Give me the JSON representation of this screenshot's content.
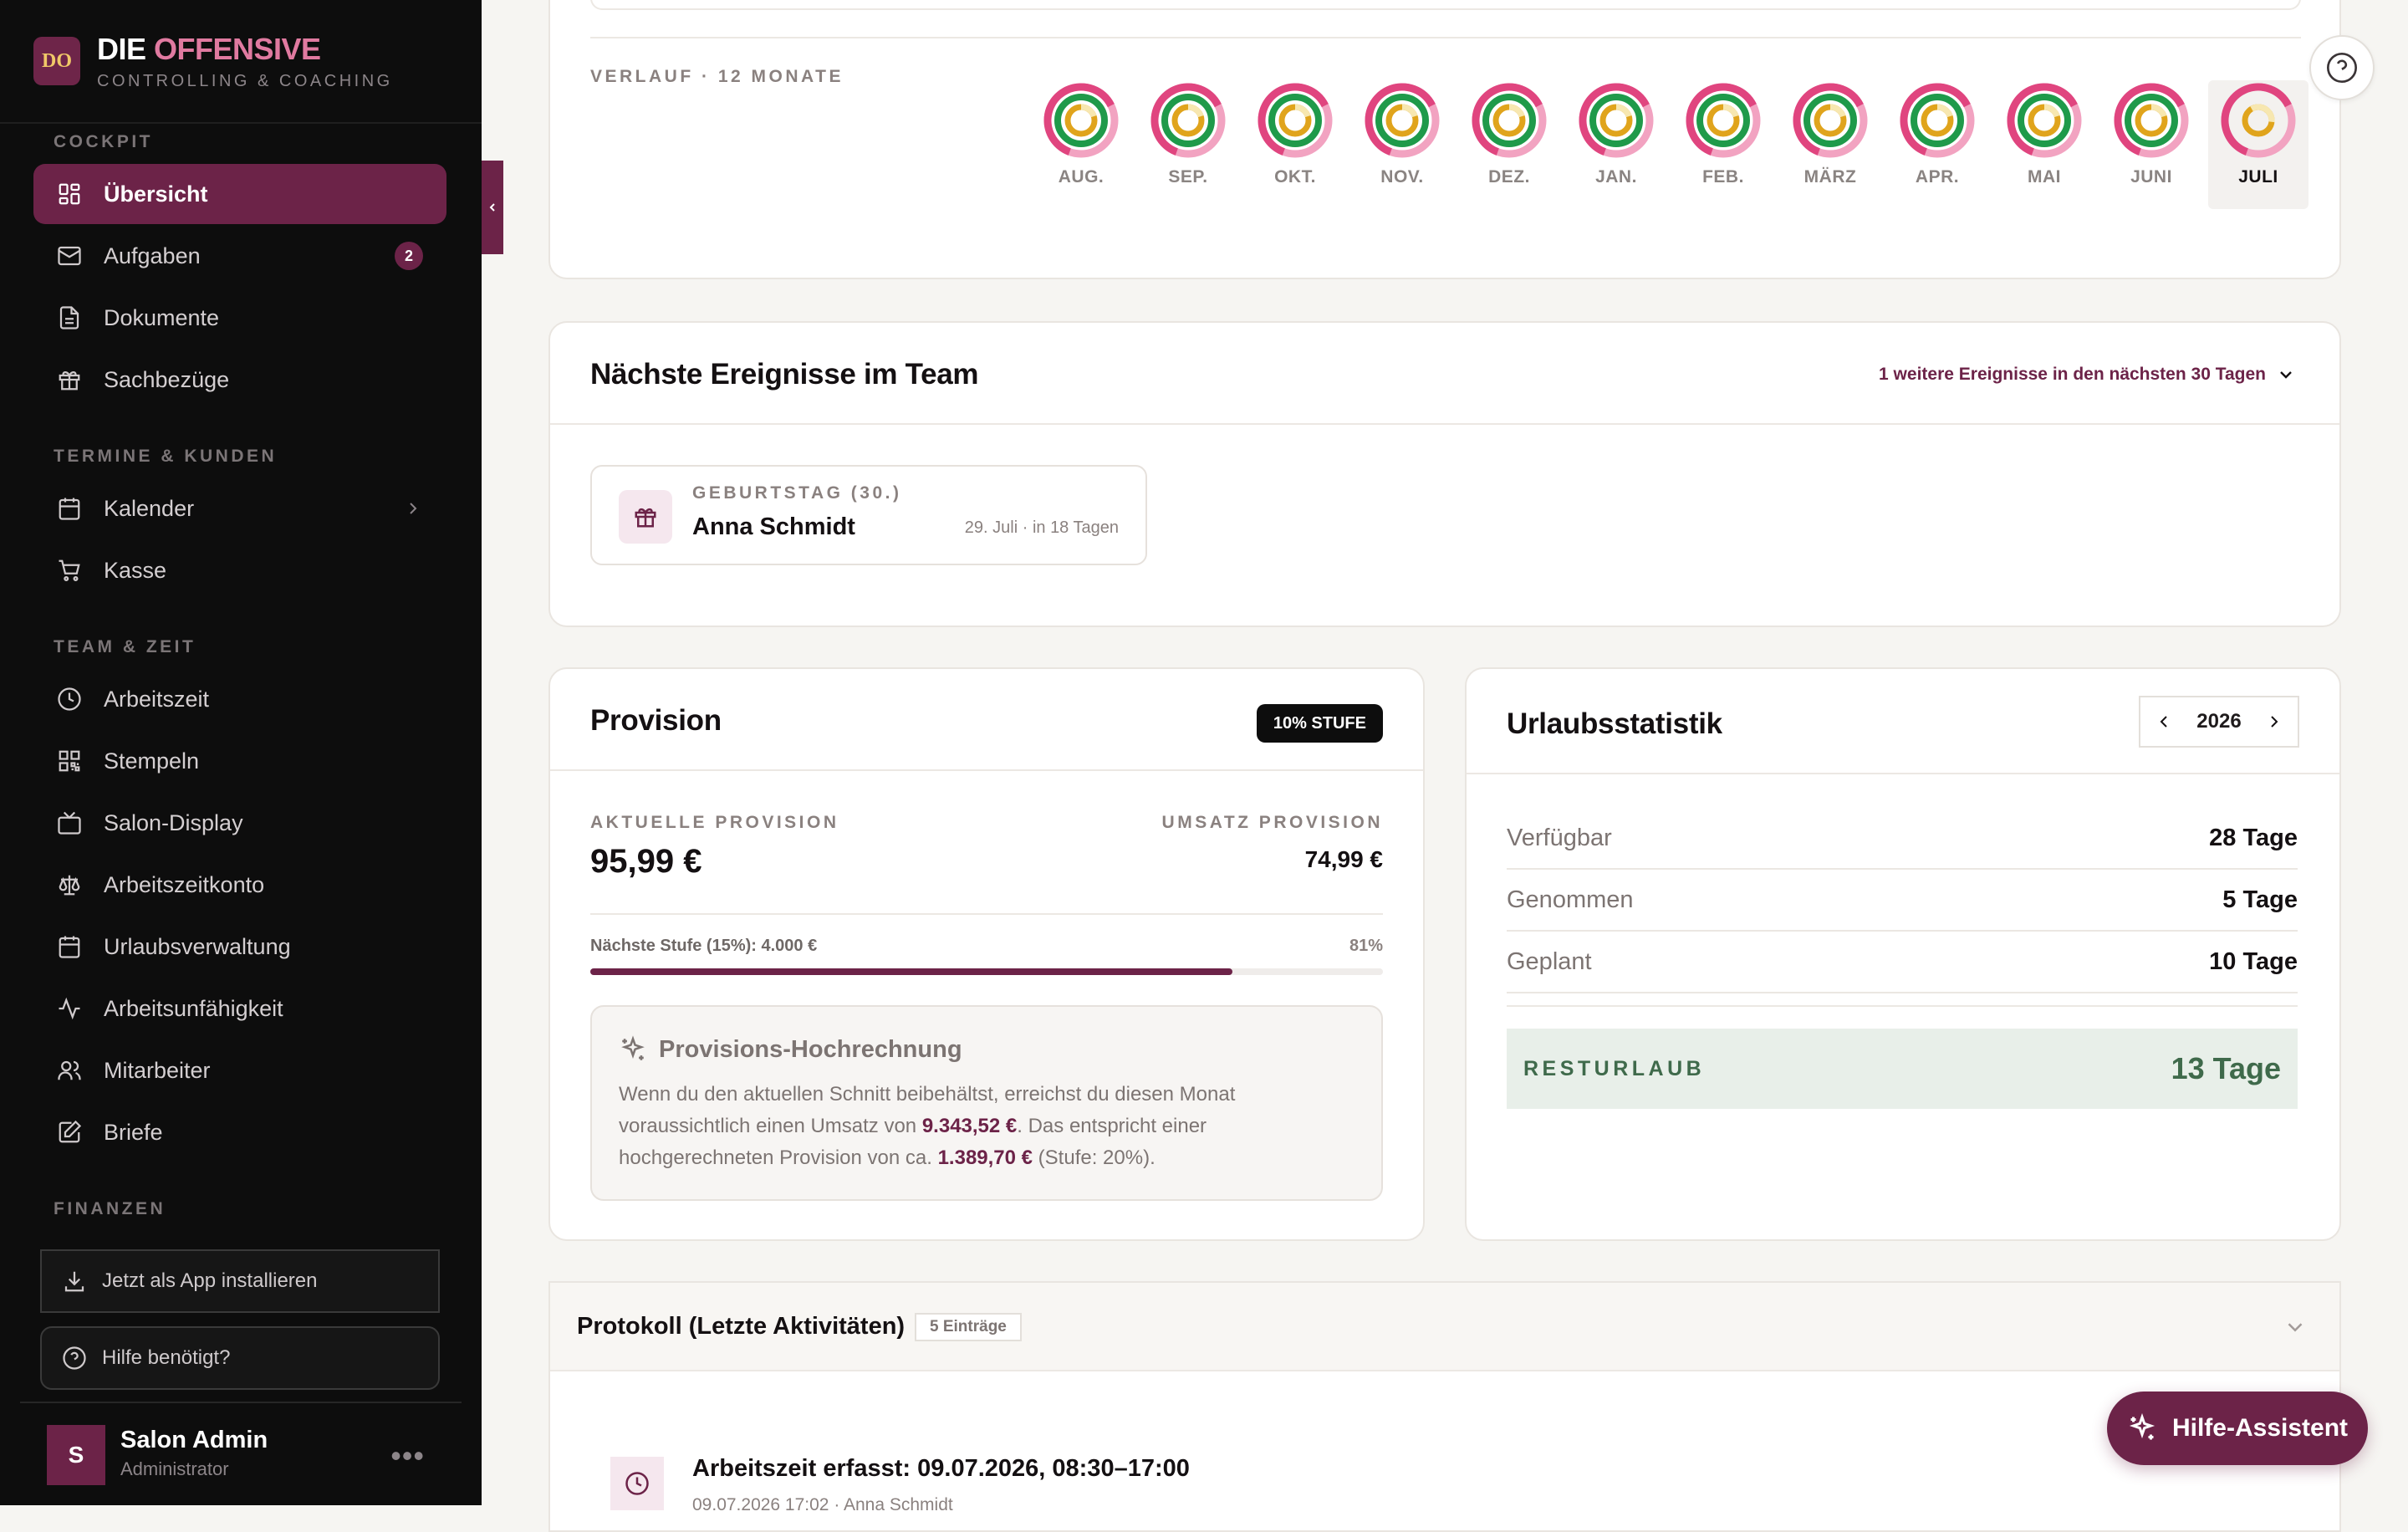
{
  "brand": {
    "name_part1": "DIE ",
    "name_part2": "OFFENSIVE",
    "subtitle": "CONTROLLING & COACHING",
    "logo_text": "DO"
  },
  "sidebar": {
    "sections": {
      "cockpit": "COCKPIT",
      "termine": "TERMINE & KUNDEN",
      "team": "TEAM & ZEIT",
      "finanzen": "FINANZEN"
    },
    "items": [
      {
        "label": "Übersicht",
        "icon": "grid-icon",
        "active": true
      },
      {
        "label": "Aufgaben",
        "icon": "mail-icon",
        "badge": "2"
      },
      {
        "label": "Dokumente",
        "icon": "document-icon"
      },
      {
        "label": "Sachbezüge",
        "icon": "gift-icon"
      },
      {
        "label": "Kalender",
        "icon": "calendar-icon"
      },
      {
        "label": "Kasse",
        "icon": "cart-icon"
      },
      {
        "label": "Arbeitszeit",
        "icon": "clock-icon"
      },
      {
        "label": "Stempeln",
        "icon": "qr-icon"
      },
      {
        "label": "Salon-Display",
        "icon": "tv-icon"
      },
      {
        "label": "Arbeitszeitkonto",
        "icon": "scale-icon"
      },
      {
        "label": "Urlaubsverwaltung",
        "icon": "calendar-icon"
      },
      {
        "label": "Arbeitsunfähigkeit",
        "icon": "activity-icon"
      },
      {
        "label": "Mitarbeiter",
        "icon": "users-icon"
      },
      {
        "label": "Briefe",
        "icon": "edit-icon"
      }
    ],
    "install_label": "Jetzt als App installieren",
    "help_label": "Hilfe benötigt?",
    "user": {
      "name": "Salon Admin",
      "role": "Administrator",
      "initial": "S",
      "more": "•••"
    }
  },
  "history": {
    "title": "VERLAUF · 12 MONATE",
    "months": [
      "AUG.",
      "SEP.",
      "OKT.",
      "NOV.",
      "DEZ.",
      "JAN.",
      "FEB.",
      "MÄRZ",
      "APR.",
      "MAI",
      "JUNI",
      "JULI"
    ],
    "selected": "JULI",
    "ring_colors": {
      "outer": "#e0457f",
      "outer_track": "#f2a3c1",
      "middle": "#1f9a4a",
      "inner": "#e0a41c"
    }
  },
  "events": {
    "title": "Nächste Ereignisse im Team",
    "more_label": "1 weitere Ereignisse in den nächsten 30 Tagen",
    "item": {
      "type": "GEBURTSTAG (30.)",
      "name": "Anna Schmidt",
      "date": "29. Juli · in 18 Tagen",
      "icon": "gift-icon"
    }
  },
  "provision": {
    "title": "Provision",
    "level_badge": "10% STUFE",
    "current_label": "AKTUELLE PROVISION",
    "current_value": "95,99 €",
    "sales_label": "UMSATZ PROVISION",
    "sales_value": "74,99 €",
    "next_label": "Nächste Stufe (15%): 4.000 €",
    "progress_label": "81%",
    "progress": 0.81,
    "projection": {
      "title": "Provisions-Hochrechnung",
      "text1": "Wenn du den aktuellen Schnitt beibehältst, erreichst du diesen Monat voraussichtlich einen Umsatz von ",
      "amount1": "9.343,52 €",
      "text2": ". Das entspricht einer hochgerechneten Provision von ca. ",
      "amount2": "1.389,70 €",
      "text3": " (Stufe: 20%)."
    }
  },
  "vacation": {
    "title": "Urlaubsstatistik",
    "year": "2026",
    "rows": [
      {
        "label": "Verfügbar",
        "value": "28 Tage"
      },
      {
        "label": "Genommen",
        "value": "5 Tage"
      },
      {
        "label": "Geplant",
        "value": "10 Tage"
      }
    ],
    "rest_label": "RESTURLAUB",
    "rest_value": "13 Tage"
  },
  "protocol": {
    "title": "Protokoll (Letzte Aktivitäten)",
    "count": "5 Einträge",
    "entry_title": "Arbeitszeit erfasst: 09.07.2026, 08:30–17:00",
    "entry_sub": "09.07.2026 17:02 · Anna Schmidt"
  },
  "assistant": {
    "label": "Hilfe-Assistent"
  }
}
